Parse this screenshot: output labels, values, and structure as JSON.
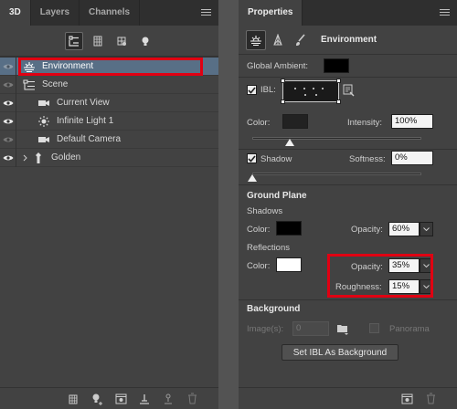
{
  "left_panel": {
    "tabs": [
      "3D",
      "Layers",
      "Channels"
    ],
    "active_tab": "3D",
    "filter_icons": [
      "whole-scene-icon",
      "meshes-icon",
      "materials-icon",
      "lights-icon"
    ],
    "tree": [
      {
        "label": "Environment",
        "icon": "environment-icon",
        "selected": true,
        "eye": false,
        "indent": 0
      },
      {
        "label": "Scene",
        "icon": "scene-icon",
        "selected": false,
        "eye": false,
        "indent": 0
      },
      {
        "label": "Current View",
        "icon": "camera-icon",
        "selected": false,
        "eye": true,
        "indent": 1
      },
      {
        "label": "Infinite Light 1",
        "icon": "sun-light-icon",
        "selected": false,
        "eye": true,
        "indent": 1
      },
      {
        "label": "Default Camera",
        "icon": "camera-icon",
        "selected": false,
        "eye": false,
        "indent": 1
      },
      {
        "label": "Golden",
        "icon": "mesh-icon",
        "selected": false,
        "eye": true,
        "indent": 0,
        "expandable": true
      }
    ],
    "bottom_icons": [
      "new-mesh-icon",
      "new-light-icon",
      "render-icon",
      "ground-plane-icon",
      "constraint-icon",
      "trash-icon"
    ]
  },
  "properties": {
    "tab": "Properties",
    "header_title": "Environment",
    "global_ambient_label": "Global Ambient:",
    "global_ambient_color": "#000000",
    "ibl_label": "IBL:",
    "ibl_checked": true,
    "color_label": "Color:",
    "color_value": "#222222",
    "intensity_label": "Intensity:",
    "intensity_value": "100%",
    "intensity_slider": 0.22,
    "shadow_label": "Shadow",
    "shadow_checked": true,
    "softness_label": "Softness:",
    "softness_value": "0%",
    "softness_slider": 0.0,
    "ground_plane_title": "Ground Plane",
    "shadows_label": "Shadows",
    "shadows_color_label": "Color:",
    "shadows_color": "#000000",
    "shadows_opacity_label": "Opacity:",
    "shadows_opacity_value": "60%",
    "reflections_label": "Reflections",
    "reflections_color_label": "Color:",
    "reflections_color": "#ffffff",
    "reflections_opacity_label": "Opacity:",
    "reflections_opacity_value": "35%",
    "roughness_label": "Roughness:",
    "roughness_value": "15%",
    "background_title": "Background",
    "images_label": "Image(s):",
    "images_value": "0",
    "panorama_label": "Panorama",
    "set_ibl_button": "Set IBL As Background",
    "bottom_icons": [
      "render-icon",
      "trash-icon"
    ]
  },
  "colors": {
    "selection": "#586f86",
    "highlight_red": "#e00012"
  }
}
